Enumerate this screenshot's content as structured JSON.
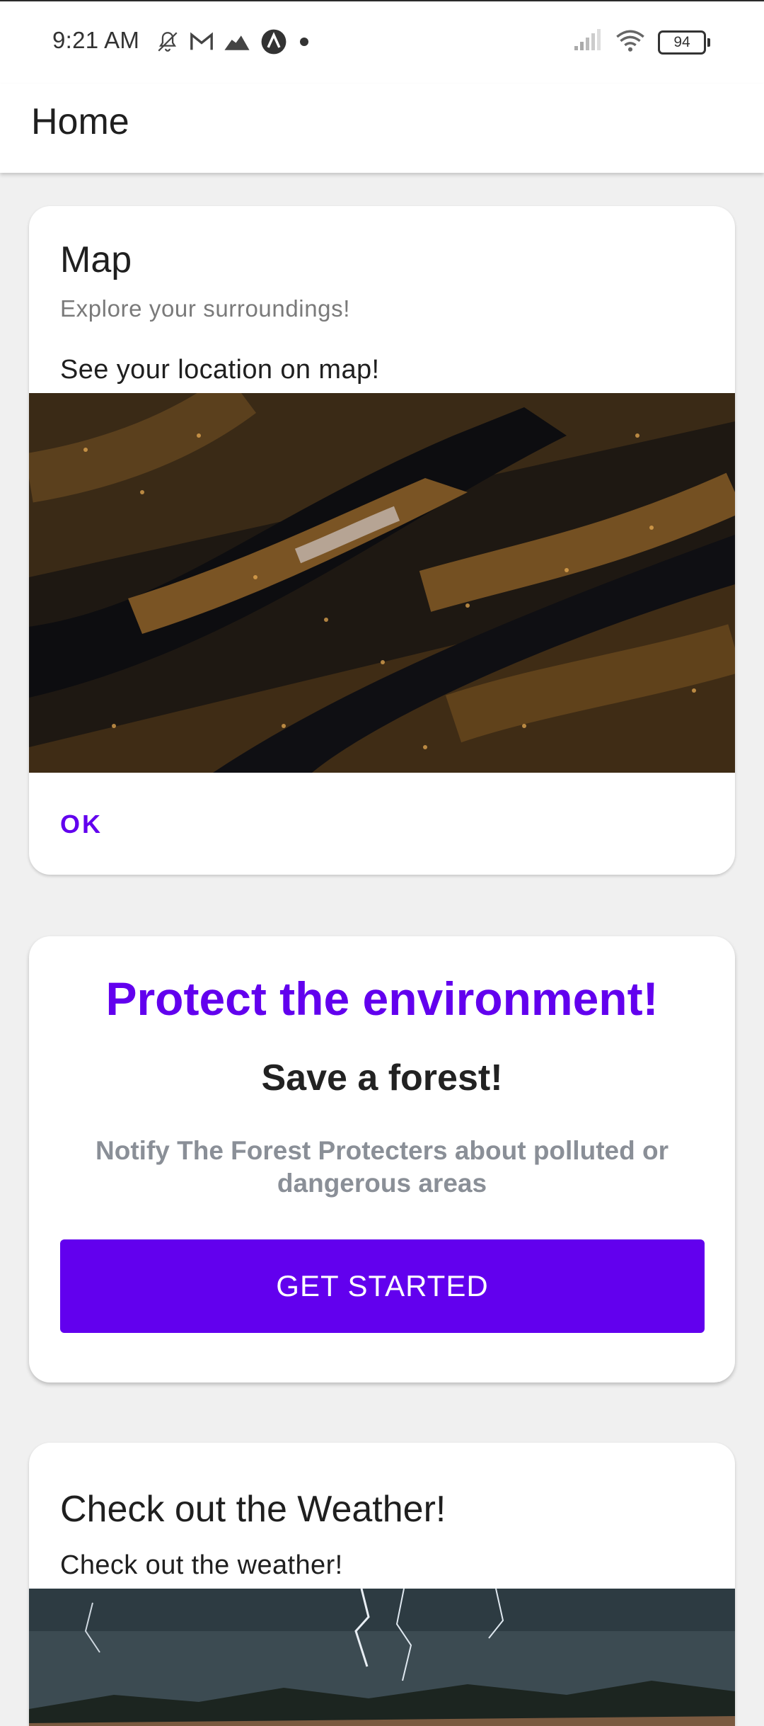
{
  "status_bar": {
    "time": "9:21 AM",
    "icons_left": [
      "notifications-off-icon",
      "gmail-icon",
      "cloud-icon",
      "app-a-icon",
      "dot-icon"
    ],
    "icons_right": [
      "signal-icon",
      "wifi-icon",
      "battery-icon"
    ],
    "battery_level": "94"
  },
  "app_bar": {
    "title": "Home"
  },
  "map_card": {
    "title": "Map",
    "subtitle": "Explore your surroundings!",
    "text": "See your location on map!",
    "image": "city-night-aerial-image",
    "ok_label": "OK"
  },
  "environment_card": {
    "title": "Protect the environment!",
    "subtitle": "Save a forest!",
    "description": "Notify The Forest Protecters about polluted or dangerous areas",
    "button_label": "GET STARTED"
  },
  "weather_card": {
    "title": "Check out the Weather!",
    "subtitle": "Check out the weather!",
    "image": "lightning-storm-image"
  },
  "colors": {
    "accent": "#6200ee",
    "background": "#f0f0f0",
    "card": "#ffffff",
    "secondary_text": "#8a8f97"
  }
}
